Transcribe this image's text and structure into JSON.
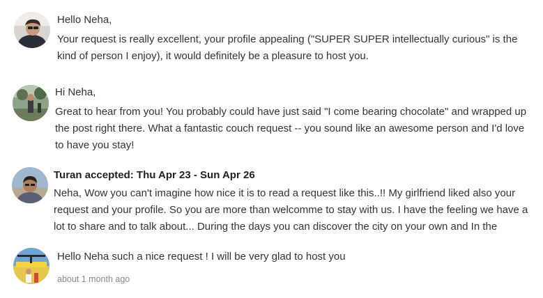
{
  "messages": [
    {
      "greeting": "Hello Neha,",
      "body": "Your request is really excellent, your profile appealing (\"SUPER SUPER intellectually curious\" is the kind of person I enjoy), it would definitely be a pleasure to host you.",
      "avatar_icon": "user-avatar-photo"
    },
    {
      "greeting": "Hi Neha,",
      "body": "Great to hear from you! You probably could have just said \"I come bearing chocolate\" and wrapped up the post right there. What a fantastic couch request -- you sound like an awesome person and I'd love to have you stay!",
      "avatar_icon": "user-avatar-photo"
    },
    {
      "header": "Turan accepted: Thu Apr 23 - Sun Apr 26",
      "body": "Neha, Wow you can't imagine how nice it is to read a request like this..!! My girlfriend liked also your request and your profile. So you are more than welcomme to stay with us. I have the feeling we have a lot to share and to talk about... During the days you can discover the city on your own and In the",
      "avatar_icon": "user-avatar-photo"
    },
    {
      "body": "Hello Neha such a nice request ! I will be very glad to host you",
      "timestamp": "about 1 month ago",
      "avatar_icon": "user-avatar-photo"
    }
  ]
}
